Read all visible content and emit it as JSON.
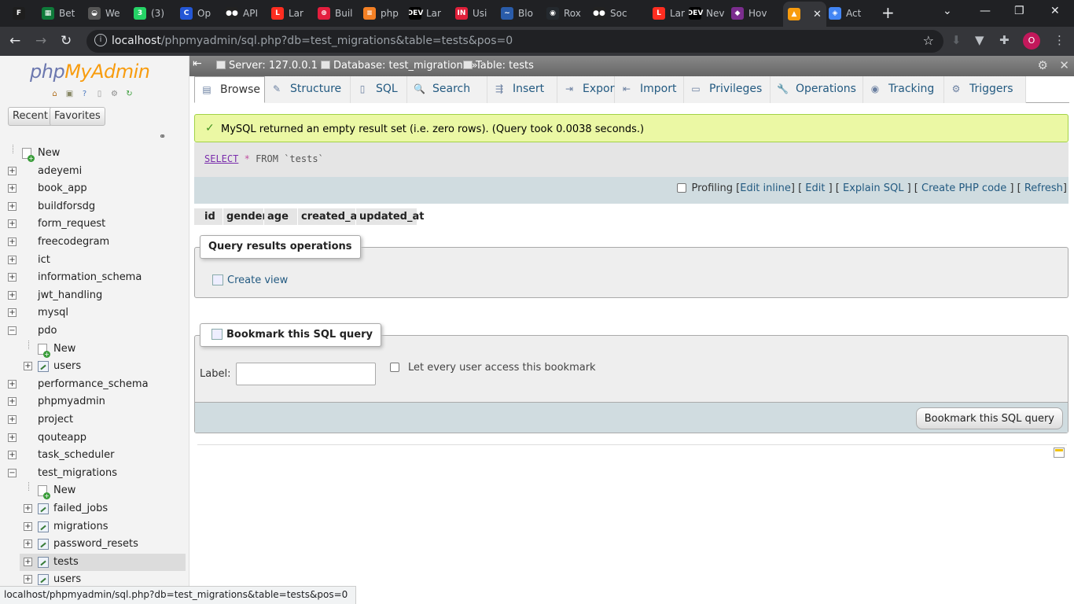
{
  "browser": {
    "tabs": [
      {
        "label": "",
        "icon": "figma-icon",
        "color": "#1e1e1e",
        "glyph": "F"
      },
      {
        "label": "Bet",
        "icon": "green-grid-icon",
        "color": "#0f7a3a",
        "glyph": "▦"
      },
      {
        "label": "We",
        "icon": "bird-icon",
        "color": "#555555",
        "glyph": "◒"
      },
      {
        "label": "(3)",
        "icon": "whatsapp-icon",
        "color": "#25d366",
        "glyph": "3"
      },
      {
        "label": "Op",
        "icon": "c-icon",
        "color": "#2457d6",
        "glyph": "C"
      },
      {
        "label": "API",
        "icon": "medium-icon",
        "color": "#222222",
        "glyph": "●●"
      },
      {
        "label": "Lar",
        "icon": "laravel-icon",
        "color": "#ff2d20",
        "glyph": "L"
      },
      {
        "label": "Buil",
        "icon": "twilio-icon",
        "color": "#e31e3e",
        "glyph": "⊕"
      },
      {
        "label": "php",
        "icon": "stackoverflow-icon",
        "color": "#f48024",
        "glyph": "≡"
      },
      {
        "label": "Lar",
        "icon": "dev-icon",
        "color": "#000000",
        "glyph": "DEV"
      },
      {
        "label": "Usi",
        "icon": "in-icon",
        "color": "#e0203a",
        "glyph": "IN"
      },
      {
        "label": "Blo",
        "icon": "swoosh-icon",
        "color": "#2a5caa",
        "glyph": "∼"
      },
      {
        "label": "Rox",
        "icon": "github-icon",
        "color": "#24292e",
        "glyph": "◉"
      },
      {
        "label": "Soc",
        "icon": "medium-icon",
        "color": "#222222",
        "glyph": "●●"
      },
      {
        "label": "Lar",
        "icon": "laravel-icon",
        "color": "#ff2d20",
        "glyph": "L"
      },
      {
        "label": "Nev",
        "icon": "dev-icon",
        "color": "#000000",
        "glyph": "DEV"
      },
      {
        "label": "Hov",
        "icon": "purple-icon",
        "color": "#7b2d8e",
        "glyph": "◆"
      },
      {
        "label": "",
        "icon": "phpmyadmin-icon",
        "color": "#f89c0e",
        "glyph": "▲"
      },
      {
        "label": "Act",
        "icon": "google-icon",
        "color": "#4285f4",
        "glyph": "◈"
      }
    ],
    "active_tab_index": 17,
    "tab_close": "✕",
    "new_tab": "+",
    "url_host": "localhost",
    "url_path": "/phpmyadmin/sql.php?db=test_migrations&table=tests&pos=0",
    "profile_initial": "O",
    "status_url": "localhost/phpmyadmin/sql.php?db=test_migrations&table=tests&pos=0"
  },
  "nav": {
    "logo_php": "php",
    "logo_myadmin": "MyAdmin",
    "recent": "Recent",
    "favorites": "Favorites",
    "tree": [
      {
        "label": "New",
        "level": 0,
        "kind": "new",
        "expander": ""
      },
      {
        "label": "adeyemi",
        "level": 0,
        "kind": "db",
        "expander": "+"
      },
      {
        "label": "book_app",
        "level": 0,
        "kind": "db",
        "expander": "+"
      },
      {
        "label": "buildforsdg",
        "level": 0,
        "kind": "db",
        "expander": "+"
      },
      {
        "label": "form_request",
        "level": 0,
        "kind": "db",
        "expander": "+"
      },
      {
        "label": "freecodegram",
        "level": 0,
        "kind": "db",
        "expander": "+"
      },
      {
        "label": "ict",
        "level": 0,
        "kind": "db",
        "expander": "+"
      },
      {
        "label": "information_schema",
        "level": 0,
        "kind": "db",
        "expander": "+"
      },
      {
        "label": "jwt_handling",
        "level": 0,
        "kind": "db",
        "expander": "+"
      },
      {
        "label": "mysql",
        "level": 0,
        "kind": "db",
        "expander": "+"
      },
      {
        "label": "pdo",
        "level": 0,
        "kind": "db",
        "expander": "−"
      },
      {
        "label": "New",
        "level": 1,
        "kind": "new",
        "expander": ""
      },
      {
        "label": "users",
        "level": 1,
        "kind": "table",
        "expander": "+"
      },
      {
        "label": "performance_schema",
        "level": 0,
        "kind": "db",
        "expander": "+"
      },
      {
        "label": "phpmyadmin",
        "level": 0,
        "kind": "db",
        "expander": "+"
      },
      {
        "label": "project",
        "level": 0,
        "kind": "db",
        "expander": "+"
      },
      {
        "label": "qouteapp",
        "level": 0,
        "kind": "db",
        "expander": "+"
      },
      {
        "label": "task_scheduler",
        "level": 0,
        "kind": "db",
        "expander": "+"
      },
      {
        "label": "test_migrations",
        "level": 0,
        "kind": "db",
        "expander": "−"
      },
      {
        "label": "New",
        "level": 1,
        "kind": "new",
        "expander": ""
      },
      {
        "label": "failed_jobs",
        "level": 1,
        "kind": "table",
        "expander": "+"
      },
      {
        "label": "migrations",
        "level": 1,
        "kind": "table",
        "expander": "+"
      },
      {
        "label": "password_resets",
        "level": 1,
        "kind": "table",
        "expander": "+"
      },
      {
        "label": "tests",
        "level": 1,
        "kind": "table",
        "expander": "+",
        "selected": true
      },
      {
        "label": "users",
        "level": 1,
        "kind": "table",
        "expander": "+"
      }
    ]
  },
  "breadcrumb": {
    "server": "Server: 127.0.0.1 »",
    "database": "Database: test_migrations »",
    "table": "Table: tests"
  },
  "tabs": [
    {
      "label": "Browse",
      "icon": "browse-icon",
      "glyph": "▤"
    },
    {
      "label": "Structure",
      "icon": "structure-icon",
      "glyph": "✎"
    },
    {
      "label": "SQL",
      "icon": "sql-icon",
      "glyph": "▯"
    },
    {
      "label": "Search",
      "icon": "search-icon",
      "glyph": "🔍"
    },
    {
      "label": "Insert",
      "icon": "insert-icon",
      "glyph": "⇶"
    },
    {
      "label": "Export",
      "icon": "export-icon",
      "glyph": "⇥"
    },
    {
      "label": "Import",
      "icon": "import-icon",
      "glyph": "⇤"
    },
    {
      "label": "Privileges",
      "icon": "privileges-icon",
      "glyph": "▭"
    },
    {
      "label": "Operations",
      "icon": "wrench-icon",
      "glyph": "🔧"
    },
    {
      "label": "Tracking",
      "icon": "eye-icon",
      "glyph": "◉"
    },
    {
      "label": "Triggers",
      "icon": "triggers-icon",
      "glyph": "⚙"
    }
  ],
  "message": {
    "text": "MySQL returned an empty result set (i.e. zero rows). (Query took 0.0038 seconds.)",
    "color": "#ebf8a4"
  },
  "sql": {
    "select": "SELECT",
    "star": "*",
    "from": "FROM",
    "table": "`tests`",
    "profiling": "Profiling",
    "edit_inline": "Edit inline",
    "edit": "Edit",
    "explain": "Explain SQL",
    "create_php": "Create PHP code",
    "refresh": "Refresh"
  },
  "columns": [
    "id",
    "gender",
    "age",
    "created_at",
    "updated_at"
  ],
  "query_ops": {
    "legend": "Query results operations",
    "create_view": "Create view"
  },
  "bookmark": {
    "legend": "Bookmark this SQL query",
    "label": "Label:",
    "input_value": "",
    "share_label": "Let every user access this bookmark",
    "button": "Bookmark this SQL query"
  }
}
